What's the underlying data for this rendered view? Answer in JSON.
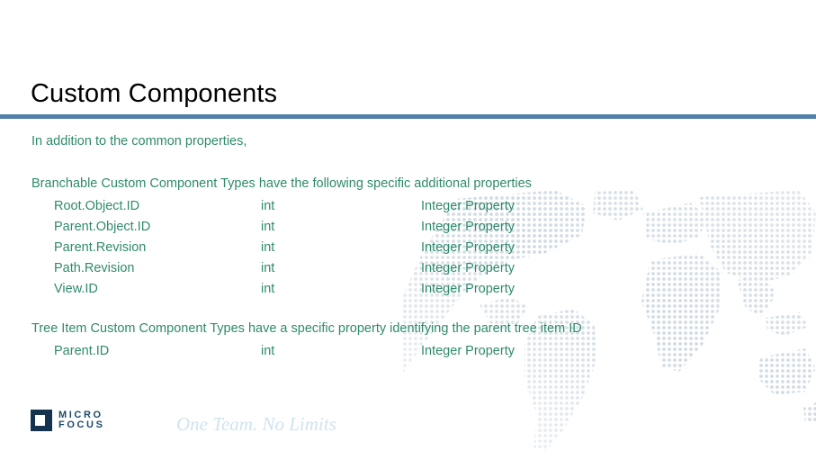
{
  "slide": {
    "title": "Custom Components",
    "intro": "In addition to the common properties,",
    "sections": [
      {
        "heading": "Branchable Custom Component Types have the following specific additional properties",
        "rows": [
          {
            "name": "Root.Object.ID",
            "type": "int",
            "desc": "Integer Property"
          },
          {
            "name": "Parent.Object.ID",
            "type": "int",
            "desc": "Integer Property"
          },
          {
            "name": "Parent.Revision",
            "type": "int",
            "desc": "Integer Property"
          },
          {
            "name": "Path.Revision",
            "type": "int",
            "desc": "Integer Property"
          },
          {
            "name": "View.ID",
            "type": "int",
            "desc": "Integer Property"
          }
        ]
      },
      {
        "heading": "Tree Item Custom Component Types have a specific property identifying the parent tree item ID",
        "rows": [
          {
            "name": "Parent.ID",
            "type": "int",
            "desc": "Integer Property"
          }
        ]
      }
    ]
  },
  "footer": {
    "logo_line1": "MICRO",
    "logo_line2": "FOCUS",
    "tagline": "One Team. No Limits"
  },
  "colors": {
    "rule": "#5180ac",
    "body_text": "#2f8a6c",
    "title_text": "#000000",
    "logo": "#1d4a6d",
    "tagline": "#cfe3f0",
    "map_dot": "#c8d4de"
  }
}
